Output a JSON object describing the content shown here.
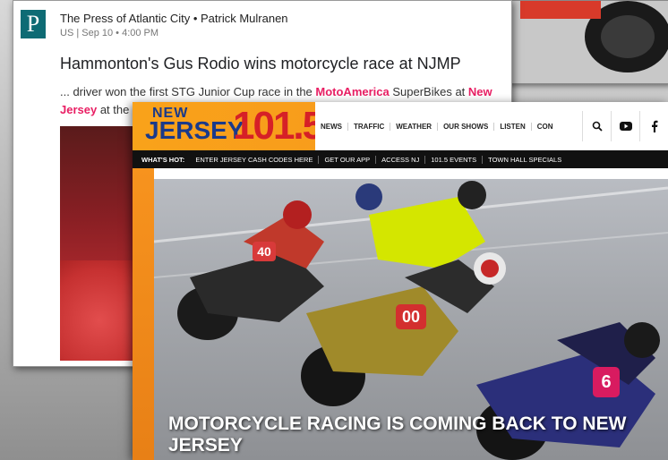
{
  "press": {
    "logo_letter": "P",
    "source": "The Press of Atlantic City • Patrick Mulranen",
    "meta": "US | Sep 10 • 4:00 PM",
    "headline": "Hammonton's Gus Rodio wins motorcycle race at NJMP",
    "snippet": {
      "part1": "... driver won the first STG Junior Cup race in the ",
      "hl1": "MotoAmerica",
      "part2": " SuperBikes at ",
      "hl2": "New Jersey",
      "part3": " at the "
    }
  },
  "nj": {
    "logo_new": "NEW",
    "logo_jersey": "JERSEY",
    "logo_freq": "101.5",
    "nav": [
      "NEWS",
      "TRAFFIC",
      "WEATHER",
      "OUR SHOWS",
      "LISTEN",
      "CON"
    ],
    "icons": [
      "search-icon",
      "youtube-icon",
      "facebook-icon"
    ],
    "hot_label": "WHAT'S HOT:",
    "hot_items": [
      "ENTER JERSEY CASH CODES HERE",
      "GET OUR APP",
      "ACCESS NJ",
      "101.5 EVENTS",
      "TOWN HALL SPECIALS"
    ],
    "hero_title": "MOTORCYCLE RACING IS COMING BACK TO NEW JERSEY",
    "bike_numbers": [
      "40",
      "00",
      "6"
    ]
  }
}
